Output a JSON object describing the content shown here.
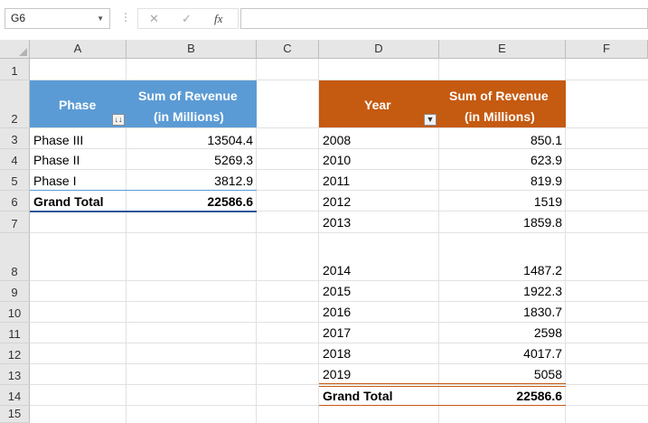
{
  "formula_bar": {
    "name_box": "G6",
    "dropdown_icon": "chevron-down-icon",
    "separator": "⋮",
    "cancel_icon": "close-icon",
    "enter_icon": "check-icon",
    "fx_label": "fx",
    "formula_value": ""
  },
  "columns": [
    "A",
    "B",
    "C",
    "D",
    "E",
    "F"
  ],
  "rows": [
    "1",
    "2",
    "3",
    "4",
    "5",
    "6",
    "7",
    "8",
    "9",
    "10",
    "11",
    "12",
    "13",
    "14",
    "15"
  ],
  "colors": {
    "pivot1_header": "#5b9bd5",
    "pivot2_header": "#c55a11"
  },
  "pivot1": {
    "row_header": "Phase",
    "value_header_line1": "Sum of Revenue",
    "value_header_line2": "(in Millions)",
    "filter_icon": "sort-descending-icon",
    "items": [
      {
        "label": "Phase III",
        "value": "13504.4"
      },
      {
        "label": "Phase II",
        "value": "5269.3"
      },
      {
        "label": "Phase I",
        "value": "3812.9"
      }
    ],
    "total_label": "Grand Total",
    "total_value": "22586.6"
  },
  "pivot2": {
    "row_header": "Year",
    "value_header_line1": "Sum of Revenue",
    "value_header_line2": "(in Millions)",
    "filter_icon": "dropdown-filter-icon",
    "items": [
      {
        "label": "2008",
        "value": "850.1"
      },
      {
        "label": "2010",
        "value": "623.9"
      },
      {
        "label": "2011",
        "value": "819.9"
      },
      {
        "label": "2012",
        "value": "1519"
      },
      {
        "label": "2013",
        "value": "1859.8"
      },
      {
        "label": "2014",
        "value": "1487.2"
      },
      {
        "label": "2015",
        "value": "1922.3"
      },
      {
        "label": "2016",
        "value": "1830.7"
      },
      {
        "label": "2017",
        "value": "2598"
      },
      {
        "label": "2018",
        "value": "4017.7"
      },
      {
        "label": "2019",
        "value": "5058"
      }
    ],
    "total_label": "Grand Total",
    "total_value": "22586.6"
  }
}
